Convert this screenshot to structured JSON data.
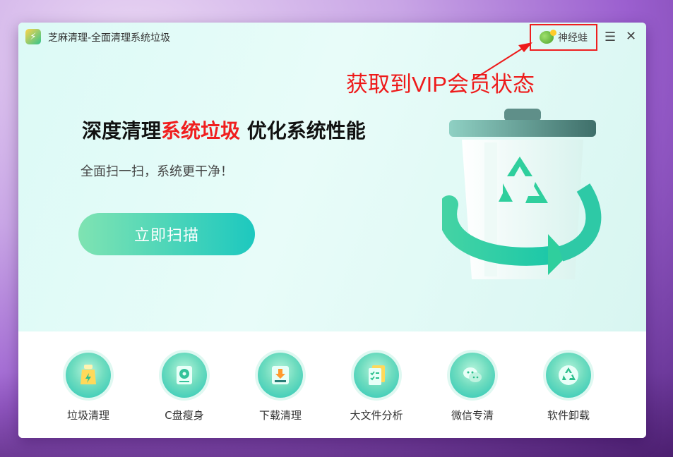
{
  "window": {
    "title": "芝麻清理-全面清理系统垃圾"
  },
  "user": {
    "name": "神经蛙"
  },
  "annotation": {
    "text": "获取到VIP会员状态"
  },
  "hero": {
    "headline_pre": "深度清理",
    "headline_highlight": "系统垃圾",
    "headline_post": " 优化系统性能",
    "subtitle": "全面扫一扫，系统更干净！",
    "scan_button": "立即扫描"
  },
  "tools": [
    {
      "label": "垃圾清理",
      "icon": "broom-icon"
    },
    {
      "label": "C盘瘦身",
      "icon": "disk-icon"
    },
    {
      "label": "下载清理",
      "icon": "download-icon"
    },
    {
      "label": "大文件分析",
      "icon": "file-analysis-icon"
    },
    {
      "label": "微信专清",
      "icon": "wechat-icon"
    },
    {
      "label": "软件卸载",
      "icon": "recycle-icon"
    }
  ],
  "colors": {
    "accent": "#1dc8bf",
    "highlight": "#f01f1f",
    "annotation": "#ee1a1a"
  }
}
